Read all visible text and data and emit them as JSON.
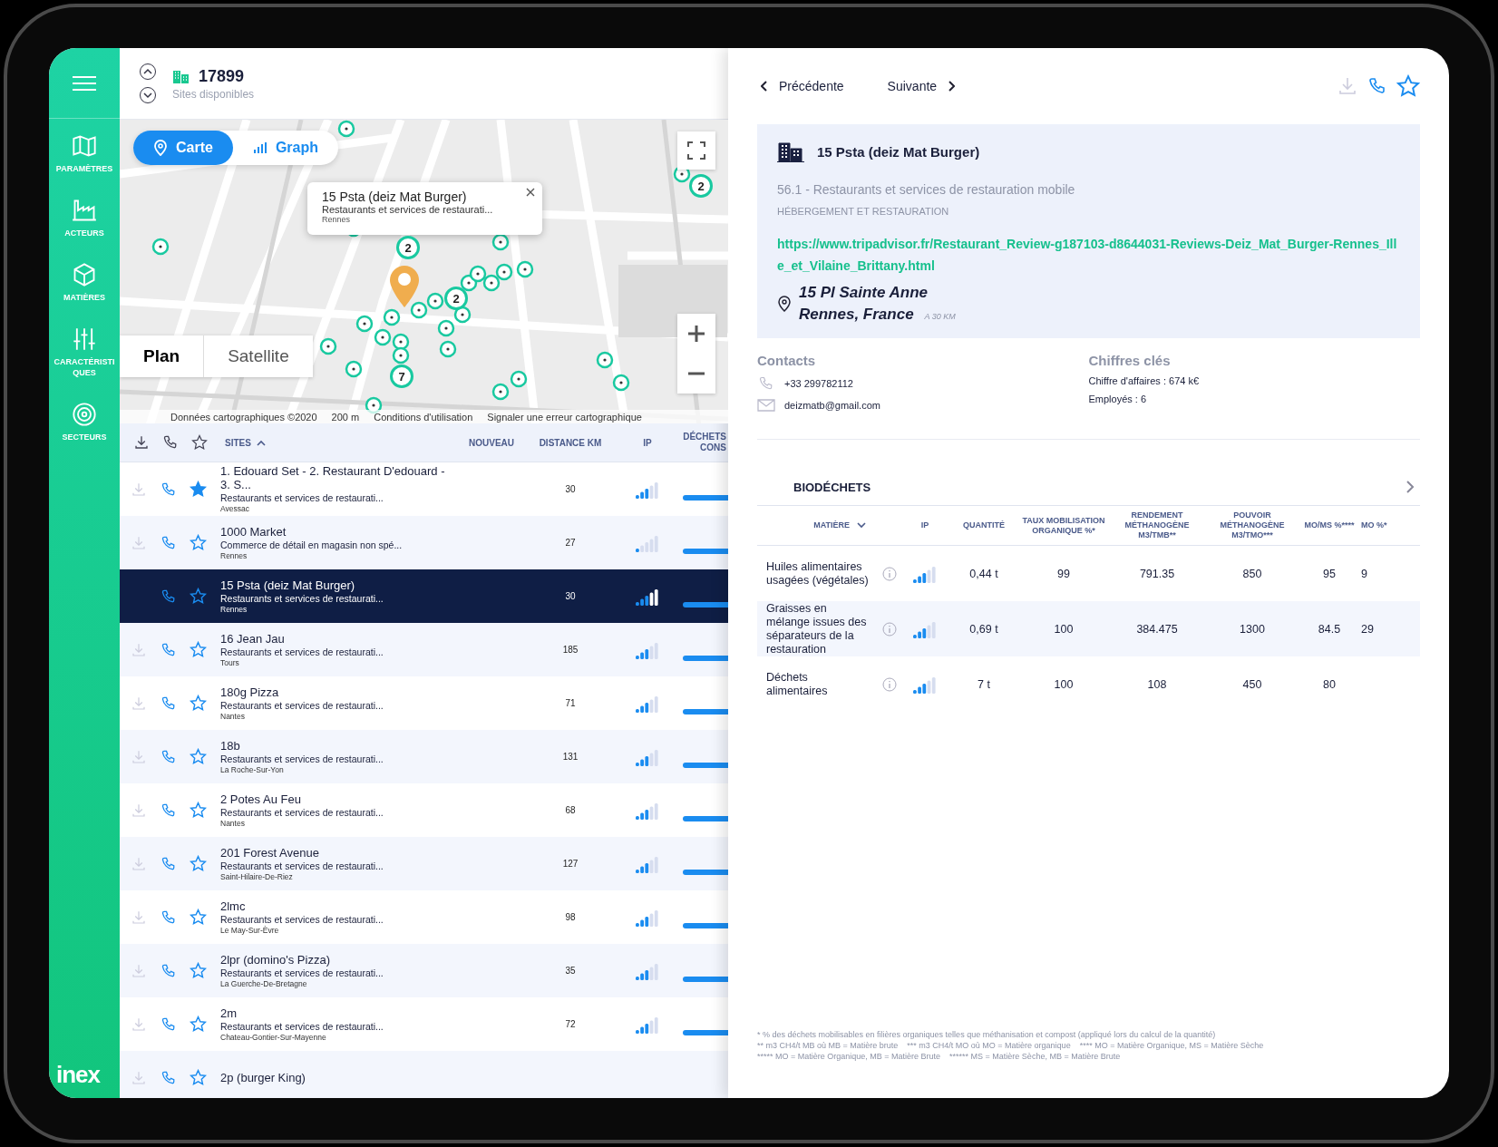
{
  "sidebar": {
    "items": [
      {
        "label": "PARAMÈTRES",
        "kind": "map"
      },
      {
        "label": "ACTEURS",
        "kind": "factory"
      },
      {
        "label": "MATIÈRES",
        "kind": "cube"
      },
      {
        "label": "CARACTÉRISTIQUES",
        "kind": "sliders"
      },
      {
        "label": "SECTEURS",
        "kind": "target"
      }
    ],
    "logo": "inex"
  },
  "header": {
    "count": "17899",
    "caption": "Sites disponibles"
  },
  "map": {
    "view_toggle": [
      {
        "label": "Carte",
        "kind": "pin",
        "selected": true
      },
      {
        "label": "Graph",
        "kind": "bars",
        "selected": false
      }
    ],
    "popup": {
      "title": "15 Psta (deiz Mat Burger)",
      "category": "Restaurants et services de restaurati...",
      "city": "Rennes"
    },
    "clusters": [
      "2",
      "2",
      "2",
      "7"
    ],
    "map_type": [
      {
        "label": "Plan",
        "selected": true
      },
      {
        "label": "Satellite",
        "selected": false
      }
    ],
    "attribution": [
      "Données cartographiques ©2020",
      "200 m",
      "Conditions d'utilisation",
      "Signaler une erreur cartographique"
    ]
  },
  "table": {
    "columns": [
      "SITES",
      "NOUVEAU",
      "DISTANCE KM",
      "IP",
      "DÉCHETS CONS"
    ],
    "rows": [
      {
        "name": "1. Edouard Set - 2. Restaurant D'edouard - 3. S...",
        "category": "Restaurants et services de restaurati...",
        "city": "Avessac",
        "distance": "30",
        "level": 0.6,
        "starred": true,
        "selected": false
      },
      {
        "name": "1000 Market",
        "category": "Commerce de détail en magasin non spé...",
        "city": "Rennes",
        "distance": "27",
        "level": 0.2,
        "starred": false,
        "selected": false
      },
      {
        "name": "15 Psta (deiz Mat Burger)",
        "category": "Restaurants et services de restaurati...",
        "city": "Rennes",
        "distance": "30",
        "level": 0.6,
        "starred": false,
        "selected": true
      },
      {
        "name": "16 Jean Jau",
        "category": "Restaurants et services de restaurati...",
        "city": "Tours",
        "distance": "185",
        "level": 0.6,
        "starred": false,
        "selected": false
      },
      {
        "name": "180g Pizza",
        "category": "Restaurants et services de restaurati...",
        "city": "Nantes",
        "distance": "71",
        "level": 0.6,
        "starred": false,
        "selected": false
      },
      {
        "name": "18b",
        "category": "Restaurants et services de restaurati...",
        "city": "La Roche-Sur-Yon",
        "distance": "131",
        "level": 0.6,
        "starred": false,
        "selected": false
      },
      {
        "name": "2 Potes Au Feu",
        "category": "Restaurants et services de restaurati...",
        "city": "Nantes",
        "distance": "68",
        "level": 0.6,
        "starred": false,
        "selected": false
      },
      {
        "name": "201 Forest Avenue",
        "category": "Restaurants et services de restaurati...",
        "city": "Saint-Hilaire-De-Riez",
        "distance": "127",
        "level": 0.6,
        "starred": false,
        "selected": false
      },
      {
        "name": "2lmc",
        "category": "Restaurants et services de restaurati...",
        "city": "Le May-Sur-Èvre",
        "distance": "98",
        "level": 0.6,
        "starred": false,
        "selected": false
      },
      {
        "name": "2lpr (domino's Pizza)",
        "category": "Restaurants et services de restaurati...",
        "city": "La Guerche-De-Bretagne",
        "distance": "35",
        "level": 0.6,
        "starred": false,
        "selected": false
      },
      {
        "name": "2m",
        "category": "Restaurants et services de restaurati...",
        "city": "Chateau-Gontier-Sur-Mayenne",
        "distance": "72",
        "level": 0.6,
        "starred": false,
        "selected": false
      },
      {
        "name": "2p (burger King)",
        "selected": false,
        "starred": false
      }
    ]
  },
  "detail": {
    "nav": [
      "Précédente",
      "Suivante"
    ],
    "starred": false,
    "title": "15 Psta (deiz Mat Burger)",
    "activity": "56.1 - Restaurants et services de restauration mobile",
    "sector": "HÉBERGEMENT ET RESTAURATION",
    "url": "https://www.tripadvisor.fr/Restaurant_Review-g187103-d8644031-Reviews-Deiz_Mat_Burger-Rennes_Ille_et_Vilaine_Brittany.html",
    "address": [
      "15 Pl Sainte Anne",
      "Rennes, France"
    ],
    "distance": "A 30 KM",
    "contacts": {
      "heading": "Contacts",
      "phone": "+33 299782112",
      "email": "deizmatb@gmail.com"
    },
    "figures": {
      "heading": "Chiffres clés",
      "lines": [
        "Chiffre d'affaires : 674 k€",
        "Employés : 6"
      ]
    }
  },
  "biodechets": {
    "title": "BIODÉCHETS",
    "columns": [
      "MATIÈRE",
      "IP",
      "QUANTITÉ",
      "TAUX MOBILISATION ORGANIQUE %*",
      "RENDEMENT MÉTHANOGÈNE M3/TMB**",
      "POUVOIR MÉTHANOGÈNE M3/TMO***",
      "MO/MS %****",
      "MO %*"
    ],
    "rows": [
      {
        "level": 0.6,
        "cells": [
          "Huiles alimentaires usagées (végétales)",
          "",
          "0,44 t",
          "99",
          "791.35",
          "850",
          "95",
          "9"
        ]
      },
      {
        "level": 0.6,
        "cells": [
          "Graisses en mélange issues des séparateurs de la restauration",
          "",
          "0,69 t",
          "100",
          "384.475",
          "1300",
          "84.5",
          "29"
        ]
      },
      {
        "level": 0.6,
        "cells": [
          "Déchets alimentaires",
          "",
          "7 t",
          "100",
          "108",
          "450",
          "80"
        ]
      }
    ]
  },
  "footnotes": [
    "* % des déchets mobilisables en filières organiques telles que méthanisation et compost (appliqué lors du calcul de la quantité)",
    "** m3 CH4/t MB où MB = Matière brute    *** m3 CH4/t MO où MO = Matière organique    **** MO = Matière Organique, MS = Matière Sèche",
    "***** MO = Matière Organique, MB = Matière Brute    ****** MS = Matière Sèche, MB = Matière Brute"
  ]
}
